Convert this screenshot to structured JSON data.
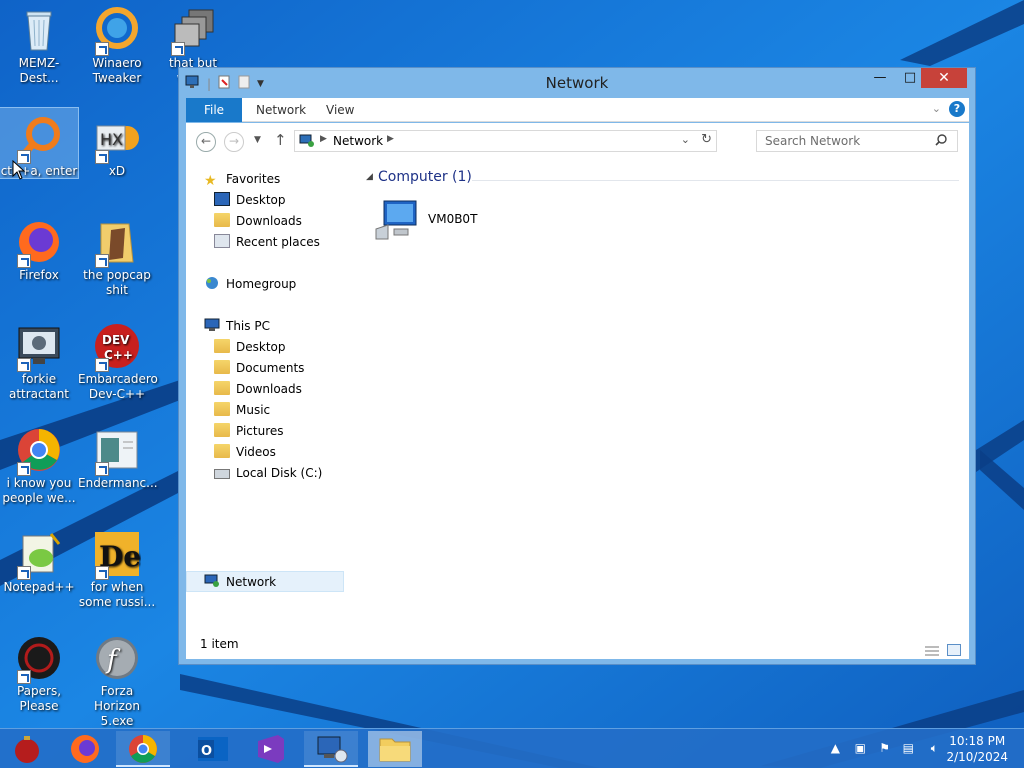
{
  "desktop": {
    "icons": [
      {
        "label": "MEMZ-Dest...",
        "icon": "recycle-bin-icon"
      },
      {
        "label": "Winaero Tweaker",
        "icon": "winaero-icon"
      },
      {
        "label": "that but when",
        "icon": "stacked-windows-icon"
      },
      {
        "label": "ctrl+a, enter",
        "icon": "magnifier-icon"
      },
      {
        "label": "xD",
        "icon": "hxd-icon"
      },
      {
        "label": "Firefox",
        "icon": "firefox-icon"
      },
      {
        "label": "the popcap shit",
        "icon": "folder-icon"
      },
      {
        "label": "forkie attractant",
        "icon": "monitor-gear-icon"
      },
      {
        "label": "Embarcadero Dev-C++",
        "icon": "devcpp-icon"
      },
      {
        "label": "i know you people we...",
        "icon": "chrome-icon"
      },
      {
        "label": "Endermanc...",
        "icon": "window-app-icon"
      },
      {
        "label": "Notepad++",
        "icon": "notepadpp-icon"
      },
      {
        "label": "for when some russi...",
        "icon": "de-icon"
      },
      {
        "label": "Papers, Please",
        "icon": "papers-please-icon"
      },
      {
        "label": "Forza Horizon 5.exe",
        "icon": "flash-icon"
      }
    ]
  },
  "window": {
    "title": "Network",
    "minimize": "—",
    "maximize": "□",
    "close": "✕",
    "ribbon_tabs": [
      "File",
      "Network",
      "View"
    ],
    "address_path": "Network",
    "search_placeholder": "Search Network",
    "nav_pane": {
      "favorites": {
        "label": "Favorites",
        "items": [
          "Desktop",
          "Downloads",
          "Recent places"
        ]
      },
      "homegroup": "Homegroup",
      "this_pc": {
        "label": "This PC",
        "items": [
          "Desktop",
          "Documents",
          "Downloads",
          "Music",
          "Pictures",
          "Videos",
          "Local Disk (C:)"
        ]
      },
      "network": "Network"
    },
    "group_header": "Computer (1)",
    "computers": [
      {
        "name": "VM0B0T"
      }
    ],
    "status": "1 item"
  },
  "taskbar": {
    "apps": [
      "ornament-icon",
      "firefox-icon",
      "chrome-icon",
      "outlook-icon",
      "visual-studio-icon",
      "network-app-icon",
      "file-explorer-icon"
    ],
    "time": "10:18 PM",
    "date": "2/10/2024"
  },
  "colors": {
    "desktop_bg": "#1574d4",
    "window_frame": "#7fb8e9",
    "file_tab": "#1979ca",
    "close_button": "#c7423a",
    "group_header_text": "#1e3287"
  }
}
